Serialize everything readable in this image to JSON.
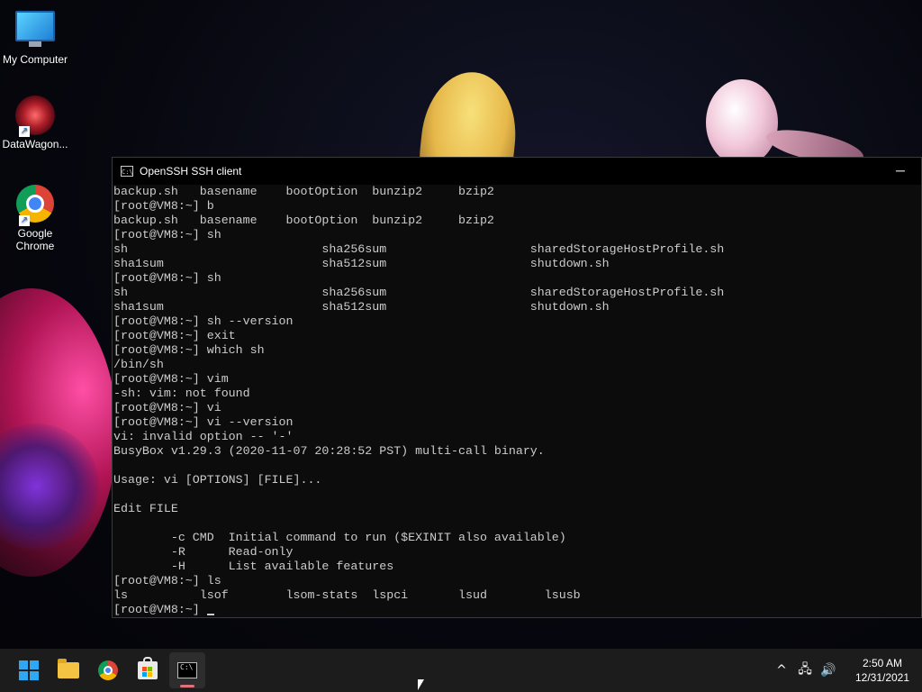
{
  "desktop": {
    "icons": [
      {
        "label": "My Computer",
        "icon": "monitor-icon"
      },
      {
        "label": "DataWagon...",
        "icon": "datawagon-star-icon"
      },
      {
        "label": "Google\nChrome",
        "icon": "chrome-icon"
      }
    ]
  },
  "terminal": {
    "title": "OpenSSH SSH client",
    "minimize_glyph": "─",
    "icon_glyph": "C:\\",
    "lines": [
      "backup.sh   basename    bootOption  bunzip2     bzip2",
      "[root@VM8:~] b",
      "backup.sh   basename    bootOption  bunzip2     bzip2",
      "[root@VM8:~] sh",
      "sh                           sha256sum                    sharedStorageHostProfile.sh",
      "sha1sum                      sha512sum                    shutdown.sh",
      "[root@VM8:~] sh",
      "sh                           sha256sum                    sharedStorageHostProfile.sh",
      "sha1sum                      sha512sum                    shutdown.sh",
      "[root@VM8:~] sh --version",
      "[root@VM8:~] exit",
      "[root@VM8:~] which sh",
      "/bin/sh",
      "[root@VM8:~] vim",
      "-sh: vim: not found",
      "[root@VM8:~] vi",
      "[root@VM8:~] vi --version",
      "vi: invalid option -- '-'",
      "BusyBox v1.29.3 (2020-11-07 20:28:52 PST) multi-call binary.",
      "",
      "Usage: vi [OPTIONS] [FILE]...",
      "",
      "Edit FILE",
      "",
      "        -c CMD  Initial command to run ($EXINIT also available)",
      "        -R      Read-only",
      "        -H      List available features",
      "[root@VM8:~] ls",
      "ls          lsof        lsom-stats  lspci       lsud        lsusb"
    ],
    "prompt": "[root@VM8:~] "
  },
  "taskbar": {
    "apps": [
      {
        "name": "start",
        "icon": "windows-logo-icon"
      },
      {
        "name": "file-explorer",
        "icon": "folder-icon"
      },
      {
        "name": "chrome",
        "icon": "chrome-icon"
      },
      {
        "name": "microsoft-store",
        "icon": "store-icon"
      },
      {
        "name": "terminal",
        "icon": "terminal-icon",
        "active": true
      }
    ],
    "tray": {
      "chevron": "^",
      "network": "🖧",
      "volume": "🔊",
      "time": "2:50 AM",
      "date": "12/31/2021"
    }
  }
}
